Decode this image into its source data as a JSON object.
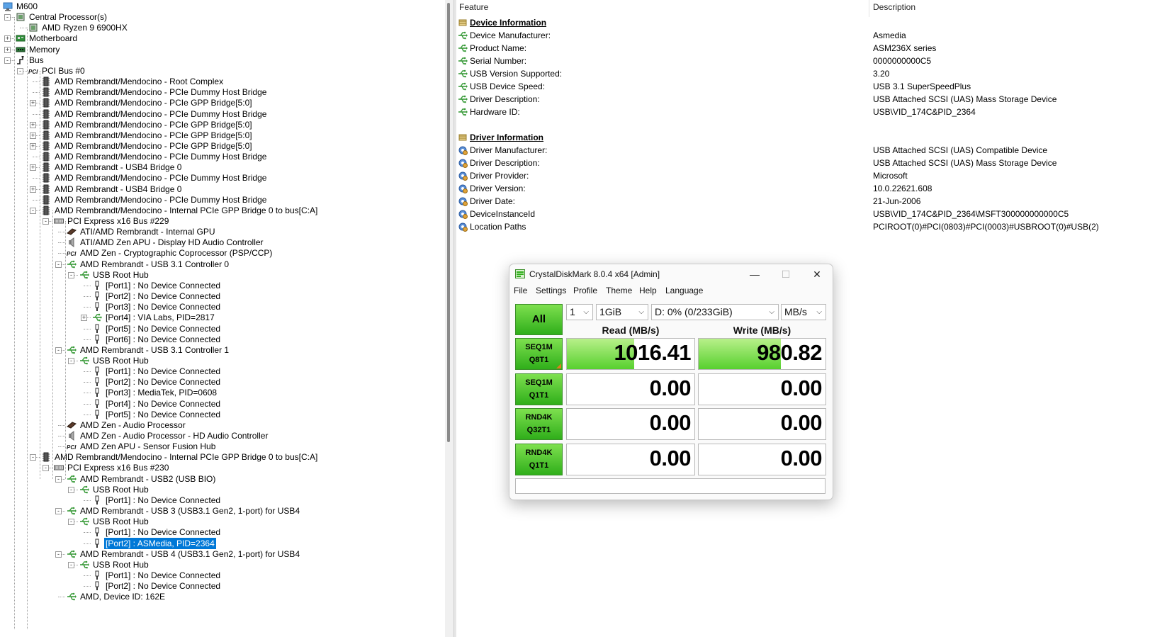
{
  "tree": {
    "root": "M600",
    "items": [
      {
        "label": "Central Processor(s)",
        "icon": "cpu-icon"
      },
      {
        "label": "AMD Ryzen 9 6900HX",
        "icon": "cpu-icon"
      },
      {
        "label": "Motherboard",
        "icon": "motherboard-icon"
      },
      {
        "label": "Memory",
        "icon": "memory-icon"
      },
      {
        "label": "Bus",
        "icon": "bus-icon"
      },
      {
        "label": "PCI Bus #0",
        "icon": "pci-icon"
      },
      {
        "label": "AMD Rembrandt/Mendocino - Root Complex",
        "icon": "chip-icon"
      },
      {
        "label": "AMD Rembrandt/Mendocino - PCIe Dummy Host Bridge",
        "icon": "chip-icon"
      },
      {
        "label": "AMD Rembrandt/Mendocino - PCIe GPP Bridge[5:0]",
        "icon": "chip-icon"
      },
      {
        "label": "AMD Rembrandt/Mendocino - PCIe Dummy Host Bridge",
        "icon": "chip-icon"
      },
      {
        "label": "AMD Rembrandt/Mendocino - PCIe GPP Bridge[5:0]",
        "icon": "chip-icon"
      },
      {
        "label": "AMD Rembrandt/Mendocino - PCIe GPP Bridge[5:0]",
        "icon": "chip-icon"
      },
      {
        "label": "AMD Rembrandt/Mendocino - PCIe GPP Bridge[5:0]",
        "icon": "chip-icon"
      },
      {
        "label": "AMD Rembrandt/Mendocino - PCIe Dummy Host Bridge",
        "icon": "chip-icon"
      },
      {
        "label": "AMD Rembrandt - USB4 Bridge 0",
        "icon": "chip-icon"
      },
      {
        "label": "AMD Rembrandt/Mendocino - PCIe Dummy Host Bridge",
        "icon": "chip-icon"
      },
      {
        "label": "AMD Rembrandt - USB4 Bridge 0",
        "icon": "chip-icon"
      },
      {
        "label": "AMD Rembrandt/Mendocino - PCIe Dummy Host Bridge",
        "icon": "chip-icon"
      },
      {
        "label": "AMD Rembrandt/Mendocino - Internal PCIe GPP Bridge 0 to bus[C:A]",
        "icon": "chip-icon"
      },
      {
        "label": "PCI Express x16 Bus #229",
        "icon": "pcie-slot-icon"
      },
      {
        "label": "ATI/AMD Rembrandt - Internal GPU",
        "icon": "gpu-icon"
      },
      {
        "label": "ATI/AMD Zen APU - Display HD Audio Controller",
        "icon": "speaker-icon"
      },
      {
        "label": "AMD Zen - Cryptographic Coprocessor (PSP/CCP)",
        "icon": "pci-icon"
      },
      {
        "label": "AMD Rembrandt - USB 3.1 Controller 0",
        "icon": "usb-icon"
      },
      {
        "label": "USB Root Hub",
        "icon": "usb-icon"
      },
      {
        "label": "[Port1] : No Device Connected",
        "icon": "usb-port-icon"
      },
      {
        "label": "[Port2] : No Device Connected",
        "icon": "usb-port-icon"
      },
      {
        "label": "[Port3] : No Device Connected",
        "icon": "usb-port-icon"
      },
      {
        "label": "[Port4] : VIA Labs, PID=2817",
        "icon": "usb-icon"
      },
      {
        "label": "[Port5] : No Device Connected",
        "icon": "usb-port-icon"
      },
      {
        "label": "[Port6] : No Device Connected",
        "icon": "usb-port-icon"
      },
      {
        "label": "AMD Rembrandt - USB 3.1 Controller 1",
        "icon": "usb-icon"
      },
      {
        "label": "USB Root Hub",
        "icon": "usb-icon"
      },
      {
        "label": "[Port1] : No Device Connected",
        "icon": "usb-port-icon"
      },
      {
        "label": "[Port2] : No Device Connected",
        "icon": "usb-port-icon"
      },
      {
        "label": "[Port3] : MediaTek, PID=0608",
        "icon": "usb-port-icon"
      },
      {
        "label": "[Port4] : No Device Connected",
        "icon": "usb-port-icon"
      },
      {
        "label": "[Port5] : No Device Connected",
        "icon": "usb-port-icon"
      },
      {
        "label": "AMD Zen - Audio Processor",
        "icon": "gpu-icon"
      },
      {
        "label": "AMD Zen - Audio Processor - HD Audio Controller",
        "icon": "speaker-icon"
      },
      {
        "label": "AMD Zen APU - Sensor Fusion Hub",
        "icon": "pci-icon"
      },
      {
        "label": "AMD Rembrandt/Mendocino - Internal PCIe GPP Bridge 0 to bus[C:A]",
        "icon": "chip-icon"
      },
      {
        "label": "PCI Express x16 Bus #230",
        "icon": "pcie-slot-icon"
      },
      {
        "label": "AMD Rembrandt - USB2 (USB BIO)",
        "icon": "usb-icon"
      },
      {
        "label": "USB Root Hub",
        "icon": "usb-icon"
      },
      {
        "label": "[Port1] : No Device Connected",
        "icon": "usb-port-icon"
      },
      {
        "label": "AMD Rembrandt - USB 3 (USB3.1 Gen2, 1-port) for USB4",
        "icon": "usb-icon"
      },
      {
        "label": "USB Root Hub",
        "icon": "usb-icon"
      },
      {
        "label": "[Port1] : No Device Connected",
        "icon": "usb-port-icon"
      },
      {
        "label": "[Port2] : ASMedia, PID=2364",
        "icon": "usb-port-icon"
      },
      {
        "label": "AMD Rembrandt - USB 4 (USB3.1 Gen2, 1-port) for USB4",
        "icon": "usb-icon"
      },
      {
        "label": "USB Root Hub",
        "icon": "usb-icon"
      },
      {
        "label": "[Port1] : No Device Connected",
        "icon": "usb-port-icon"
      },
      {
        "label": "[Port2] : No Device Connected",
        "icon": "usb-port-icon"
      },
      {
        "label": "AMD, Device ID: 162E",
        "icon": "usb-icon"
      }
    ]
  },
  "details": {
    "col_feature": "Feature",
    "col_description": "Description",
    "rows": [
      {
        "name": "Device Information",
        "value": "",
        "section": true,
        "icon": "section-icon"
      },
      {
        "name": "Device Manufacturer:",
        "value": "Asmedia",
        "icon": "usb-icon"
      },
      {
        "name": "Product Name:",
        "value": "ASM236X series",
        "icon": "usb-icon"
      },
      {
        "name": "Serial Number:",
        "value": "0000000000C5",
        "icon": "usb-icon"
      },
      {
        "name": "USB Version Supported:",
        "value": "3.20",
        "icon": "usb-icon"
      },
      {
        "name": "USB Device Speed:",
        "value": "USB 3.1 SuperSpeedPlus",
        "icon": "usb-icon"
      },
      {
        "name": "Driver Description:",
        "value": "USB Attached SCSI (UAS) Mass Storage Device",
        "icon": "usb-icon"
      },
      {
        "name": "Hardware ID:",
        "value": "USB\\VID_174C&PID_2364",
        "icon": "usb-icon"
      },
      {
        "name": "",
        "value": "",
        "spacer": true
      },
      {
        "name": "Driver Information",
        "value": "",
        "section": true,
        "icon": "section-icon"
      },
      {
        "name": "Driver Manufacturer:",
        "value": "USB Attached SCSI (UAS) Compatible Device",
        "icon": "gear-icon"
      },
      {
        "name": "Driver Description:",
        "value": "USB Attached SCSI (UAS) Mass Storage Device",
        "icon": "gear-icon"
      },
      {
        "name": "Driver Provider:",
        "value": "Microsoft",
        "icon": "gear-icon"
      },
      {
        "name": "Driver Version:",
        "value": "10.0.22621.608",
        "icon": "gear-icon"
      },
      {
        "name": "Driver Date:",
        "value": "21-Jun-2006",
        "icon": "gear-icon"
      },
      {
        "name": "DeviceInstanceId",
        "value": "USB\\VID_174C&PID_2364\\MSFT300000000000C5",
        "icon": "gear-icon"
      },
      {
        "name": "Location Paths",
        "value": "PCIROOT(0)#PCI(0803)#PCI(0003)#USBROOT(0)#USB(2)",
        "icon": "gear-icon"
      }
    ]
  },
  "cdm": {
    "title": "CrystalDiskMark 8.0.4 x64 [Admin]",
    "window_controls": {
      "minimize": "—",
      "maximize": "☐",
      "close": "✕"
    },
    "menu": [
      "File",
      "Settings",
      "Profile",
      "Theme",
      "Help",
      "Language"
    ],
    "all_label": "All",
    "count": "1",
    "size": "1GiB",
    "drive": "D: 0% (0/233GiB)",
    "unit": "MB/s",
    "read_header": "Read (MB/s)",
    "write_header": "Write (MB/s)",
    "tests": [
      {
        "line1": "SEQ1M",
        "line2": "Q8T1",
        "read": "1016.41",
        "write": "980.82",
        "read_fill": 0.53,
        "write_fill": 0.65
      },
      {
        "line1": "SEQ1M",
        "line2": "Q1T1",
        "read": "0.00",
        "write": "0.00",
        "read_fill": 0,
        "write_fill": 0
      },
      {
        "line1": "RND4K",
        "line2": "Q32T1",
        "read": "0.00",
        "write": "0.00",
        "read_fill": 0,
        "write_fill": 0
      },
      {
        "line1": "RND4K",
        "line2": "Q1T1",
        "read": "0.00",
        "write": "0.00",
        "read_fill": 0,
        "write_fill": 0
      }
    ],
    "comment": ""
  },
  "colors": {
    "selection": "#0078d7",
    "cdm_green": "#2fae1a",
    "usb_green": "#3a9b3a"
  }
}
